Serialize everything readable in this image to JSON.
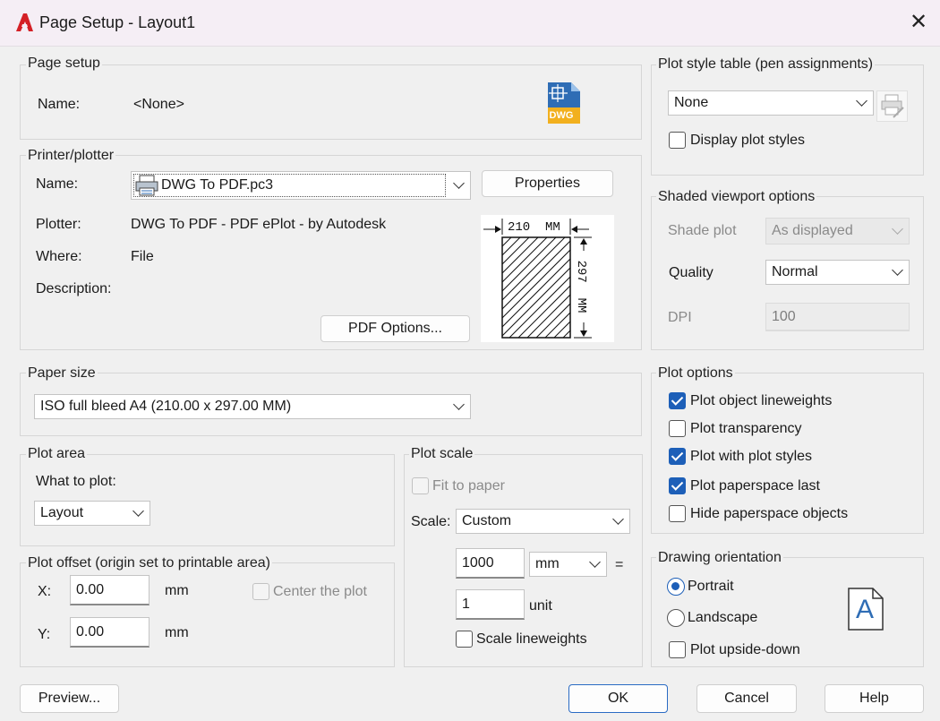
{
  "window": {
    "title": "Page Setup - Layout1"
  },
  "page_setup": {
    "legend": "Page setup",
    "name_label": "Name:",
    "name_value": "<None>",
    "dwg_badge": "DWG"
  },
  "printer": {
    "legend": "Printer/plotter",
    "name_label": "Name:",
    "name_value": "DWG To PDF.pc3",
    "properties_button": "Properties",
    "plotter_label": "Plotter:",
    "plotter_value": "DWG To PDF - PDF ePlot - by Autodesk",
    "where_label": "Where:",
    "where_value": "File",
    "description_label": "Description:",
    "pdf_options_button": "PDF Options...",
    "preview_width": "210  MM",
    "preview_height": "297  MM"
  },
  "paper_size": {
    "legend": "Paper size",
    "value": "ISO full bleed A4 (210.00 x 297.00 MM)"
  },
  "plot_area": {
    "legend": "Plot area",
    "what_label": "What to plot:",
    "what_value": "Layout"
  },
  "plot_offset": {
    "legend": "Plot offset (origin set to printable area)",
    "x_label": "X:",
    "x_value": "0.00",
    "x_unit": "mm",
    "y_label": "Y:",
    "y_value": "0.00",
    "y_unit": "mm",
    "center_label": "Center the plot"
  },
  "plot_scale": {
    "legend": "Plot scale",
    "fit_label": "Fit to paper",
    "scale_label": "Scale:",
    "scale_value": "Custom",
    "value1": "1000",
    "unit1": "mm",
    "equals": "=",
    "value2": "1",
    "unit2": "unit",
    "scale_lineweights_label": "Scale lineweights"
  },
  "plot_style_table": {
    "legend": "Plot style table (pen assignments)",
    "value": "None",
    "display_label": "Display plot styles"
  },
  "shaded_viewport": {
    "legend": "Shaded viewport options",
    "shade_label": "Shade plot",
    "shade_value": "As displayed",
    "quality_label": "Quality",
    "quality_value": "Normal",
    "dpi_label": "DPI",
    "dpi_value": "100"
  },
  "plot_options": {
    "legend": "Plot options",
    "items": [
      {
        "label": "Plot object lineweights",
        "checked": true
      },
      {
        "label": "Plot transparency",
        "checked": false
      },
      {
        "label": "Plot with plot styles",
        "checked": true
      },
      {
        "label": "Plot paperspace last",
        "checked": true
      },
      {
        "label": "Hide paperspace objects",
        "checked": false
      }
    ]
  },
  "orientation": {
    "legend": "Drawing orientation",
    "portrait_label": "Portrait",
    "landscape_label": "Landscape",
    "upside_down_label": "Plot upside-down",
    "icon_letter": "A"
  },
  "footer": {
    "preview_button": "Preview...",
    "ok_button": "OK",
    "cancel_button": "Cancel",
    "help_button": "Help"
  },
  "colors": {
    "accent": "#1d5fb8",
    "dwg_blue": "#2f6db5",
    "dwg_yellow": "#f2b01e",
    "autocad_red": "#d42026"
  }
}
